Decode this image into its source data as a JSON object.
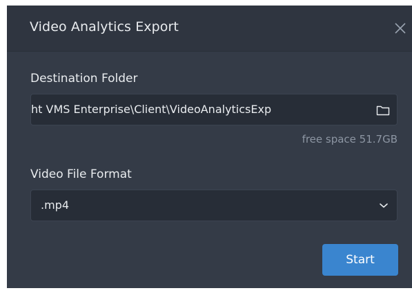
{
  "dialog": {
    "title": "Video Analytics Export",
    "close_icon": "close-icon"
  },
  "destination": {
    "label": "Destination Folder",
    "path_value": "ht VMS Enterprise\\Client\\VideoAnalyticsExp",
    "folder_icon": "folder-icon",
    "free_space": "free space 51.7GB"
  },
  "format": {
    "label": "Video File Format",
    "selected": ".mp4",
    "chevron_icon": "chevron-down-icon"
  },
  "actions": {
    "start_label": "Start"
  },
  "colors": {
    "dialog_bg": "#343b47",
    "field_bg": "#272d37",
    "accent": "#3a85cf",
    "muted_text": "#8d96a3"
  }
}
